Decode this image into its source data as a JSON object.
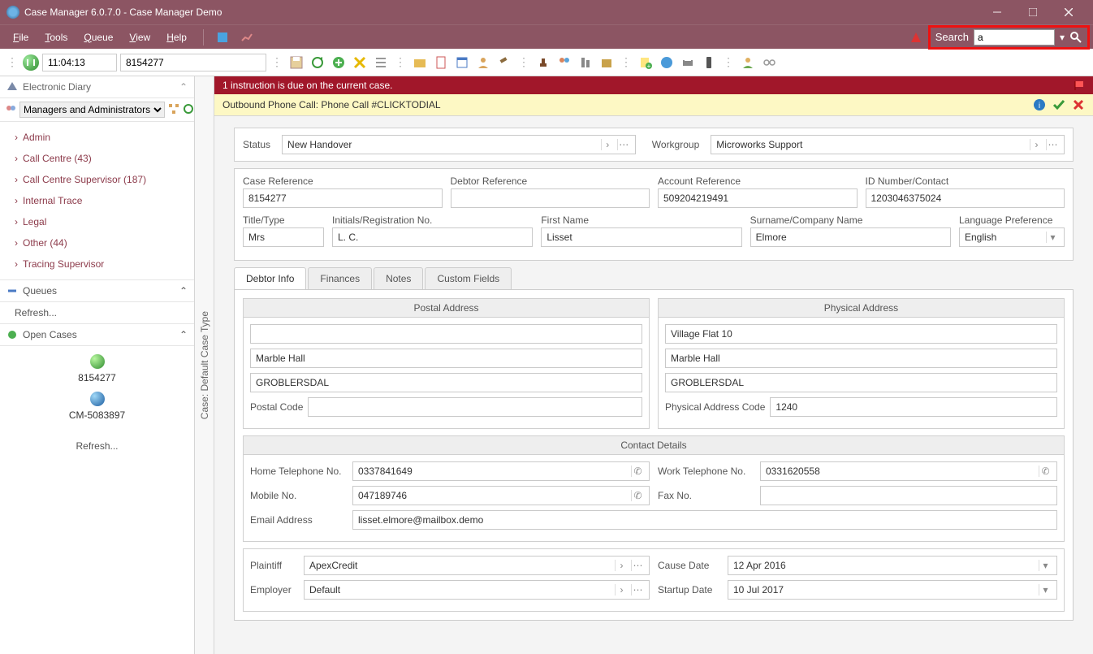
{
  "window": {
    "title": "Case Manager 6.0.7.0 - Case Manager Demo"
  },
  "menu": {
    "file": "File",
    "tools": "Tools",
    "queue": "Queue",
    "view": "View",
    "help": "Help"
  },
  "search": {
    "label": "Search",
    "value": "a"
  },
  "toolbar": {
    "time": "11:04:13",
    "case_no": "8154277"
  },
  "sidebar": {
    "diary_title": "Electronic Diary",
    "group_select": "Managers and Administrators",
    "nodes": [
      "Admin",
      "Call Centre (43)",
      "Call Centre Supervisor (187)",
      "Internal Trace",
      "Legal",
      "Other (44)",
      "Tracing Supervisor"
    ],
    "queues_title": "Queues",
    "refresh": "Refresh...",
    "open_cases_title": "Open Cases",
    "open1": "8154277",
    "open2": "CM-5083897"
  },
  "banner_red": "1 instruction is due on the current case.",
  "banner_yellow": "Outbound Phone Call: Phone Call #CLICKTODIAL",
  "vtab": "Case: Default Case Type",
  "form": {
    "status_lbl": "Status",
    "status_val": "New Handover",
    "workgroup_lbl": "Workgroup",
    "workgroup_val": "Microworks Support",
    "case_ref_lbl": "Case Reference",
    "case_ref_val": "8154277",
    "debtor_ref_lbl": "Debtor Reference",
    "debtor_ref_val": "",
    "account_ref_lbl": "Account Reference",
    "account_ref_val": "509204219491",
    "id_no_lbl": "ID Number/Contact",
    "id_no_val": "1203046375024",
    "title_lbl": "Title/Type",
    "title_val": "Mrs",
    "initials_lbl": "Initials/Registration No.",
    "initials_val": "L. C.",
    "first_lbl": "First Name",
    "first_val": "Lisset",
    "surname_lbl": "Surname/Company Name",
    "surname_val": "Elmore",
    "lang_lbl": "Language Preference",
    "lang_val": "English"
  },
  "tabs": {
    "t1": "Debtor Info",
    "t2": "Finances",
    "t3": "Notes",
    "t4": "Custom Fields"
  },
  "addr": {
    "postal_head": "Postal Address",
    "postal_lines": [
      "",
      "Marble Hall",
      "GROBLERSDAL"
    ],
    "postal_code_lbl": "Postal Code",
    "postal_code_val": "",
    "phys_head": "Physical Address",
    "phys_lines": [
      "Village Flat 10",
      "Marble Hall",
      "GROBLERSDAL"
    ],
    "phys_code_lbl": "Physical Address Code",
    "phys_code_val": "1240"
  },
  "contact": {
    "head": "Contact Details",
    "home_lbl": "Home Telephone No.",
    "home_val": "0337841649",
    "work_lbl": "Work Telephone No.",
    "work_val": "0331620558",
    "mobile_lbl": "Mobile No.",
    "mobile_val": "047189746",
    "fax_lbl": "Fax No.",
    "fax_val": "",
    "email_lbl": "Email Address",
    "email_val": "lisset.elmore@mailbox.demo"
  },
  "extra": {
    "plaintiff_lbl": "Plaintiff",
    "plaintiff_val": "ApexCredit",
    "cause_lbl": "Cause Date",
    "cause_val": "12 Apr 2016",
    "employer_lbl": "Employer",
    "employer_val": "Default",
    "startup_lbl": "Startup Date",
    "startup_val": "10 Jul 2017"
  }
}
